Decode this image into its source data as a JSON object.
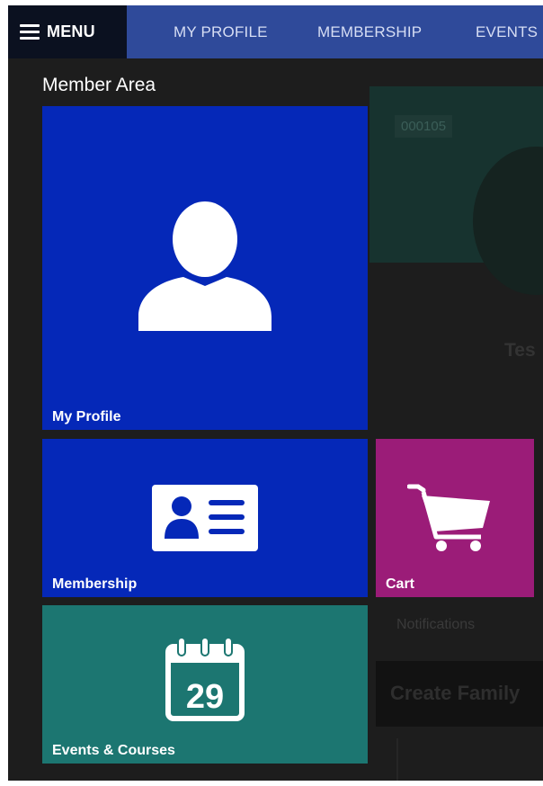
{
  "nav": {
    "menu_label": "MENU",
    "links": [
      {
        "label": "MY PROFILE"
      },
      {
        "label": "MEMBERSHIP"
      },
      {
        "label": "EVENTS"
      }
    ]
  },
  "section_title": "Member Area",
  "tiles": [
    {
      "label": "My Profile",
      "icon": "user-icon",
      "color": "#0528b8"
    },
    {
      "label": "Membership",
      "icon": "id-card-icon",
      "color": "#0528b8"
    },
    {
      "label": "Cart",
      "icon": "cart-icon",
      "color": "#9b1c78"
    },
    {
      "label": "Events & Courses",
      "icon": "calendar-icon",
      "color": "#1c7671"
    }
  ],
  "calendar_day": "29",
  "background": {
    "member_id": "000105",
    "name_partial": "Tes",
    "notifications_label": "Notifications",
    "family_heading": "Create Family"
  },
  "colors": {
    "nav_bar": "#2f4a9a",
    "menu_button": "#0b1120",
    "page_background": "#1d1d1d"
  }
}
